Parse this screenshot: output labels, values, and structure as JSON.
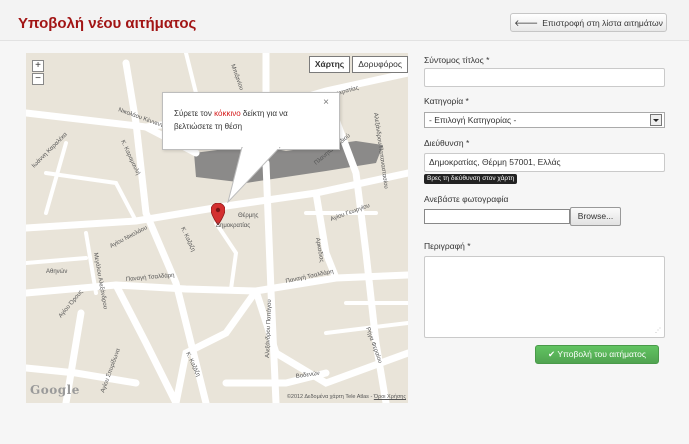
{
  "header": {
    "title": "Υποβολή νέου αιτήματος",
    "back_label": "Επιστροφή στη λίστα αιτημάτων",
    "back_icon": "arrow-left-icon"
  },
  "map": {
    "type_map": "Χάρτης",
    "type_satellite": "Δορυφόρος",
    "zoom_in": "+",
    "zoom_out": "−",
    "bubble_pre": "Σύρετε τον ",
    "bubble_red": "κόκκινο",
    "bubble_post": " δείκτη για να βελτιώσετε τη θέση",
    "bubble_close": "×",
    "watermark": "Google",
    "copyright": "©2012 Δεδομένα χάρτη Tele Atlas - ",
    "terms": "Όροι Χρήσης",
    "street_labels": [
      "Μπιζανίου",
      "Νικολάου Κέννεντυ",
      "Κ. Καραμανλή",
      "Αλεξάνδρου Παπαναστασίου",
      "Δημοκρατίας",
      "Πλανητα Παιδιού",
      "Αγίου Γεωργίου",
      "Αρκαδίας",
      "Ιωάννη Καραλέκα",
      "Αγίου Νικολάου",
      "Αθηνών",
      "Κ. Καζαζη",
      "Παναγή Τσαλδάρη",
      "Αγίου Όρους",
      "Μεγάλου Αλεξάνδρου",
      "Αλεξάνδρου Παπάγου",
      "Ρήγα Φεραίου",
      "Βοδενών",
      "Αγίου Σπυρίδωνα",
      "Ιερού Κρομμάτων",
      "Κ. Καζάζη",
      "Καραμανλή",
      "Βενιζέλου",
      "Ελ. Βενιζέλου",
      "Πυλαρίου",
      "Βοσπόρου",
      "Φαρμακείο",
      "Θέρμης"
    ],
    "pin_label": "Δημοκρατίας",
    "pin_label2": "Θέρμης",
    "pin_color": "#d32f2f"
  },
  "form": {
    "title_label": "Σύντομος τίτλος *",
    "title_value": "",
    "category_label": "Κατηγορία *",
    "category_selected": "- Επιλογή Κατηγορίας -",
    "address_label": "Διεύθυνση *",
    "address_value": "Δημοκρατίας, Θέρμη 57001, Ελλάς",
    "address_tip": "Βρες τη διεύθυνση στον χάρτη",
    "photo_label": "Ανεβάστε φωτογραφία",
    "browse_label": "Browse...",
    "description_label": "Περιγραφή *",
    "description_value": "",
    "submit_label": "Υποβολή του αιτήματος",
    "submit_icon": "check-icon"
  },
  "colors": {
    "title_red": "#a21515",
    "submit_green": "#51a351"
  }
}
